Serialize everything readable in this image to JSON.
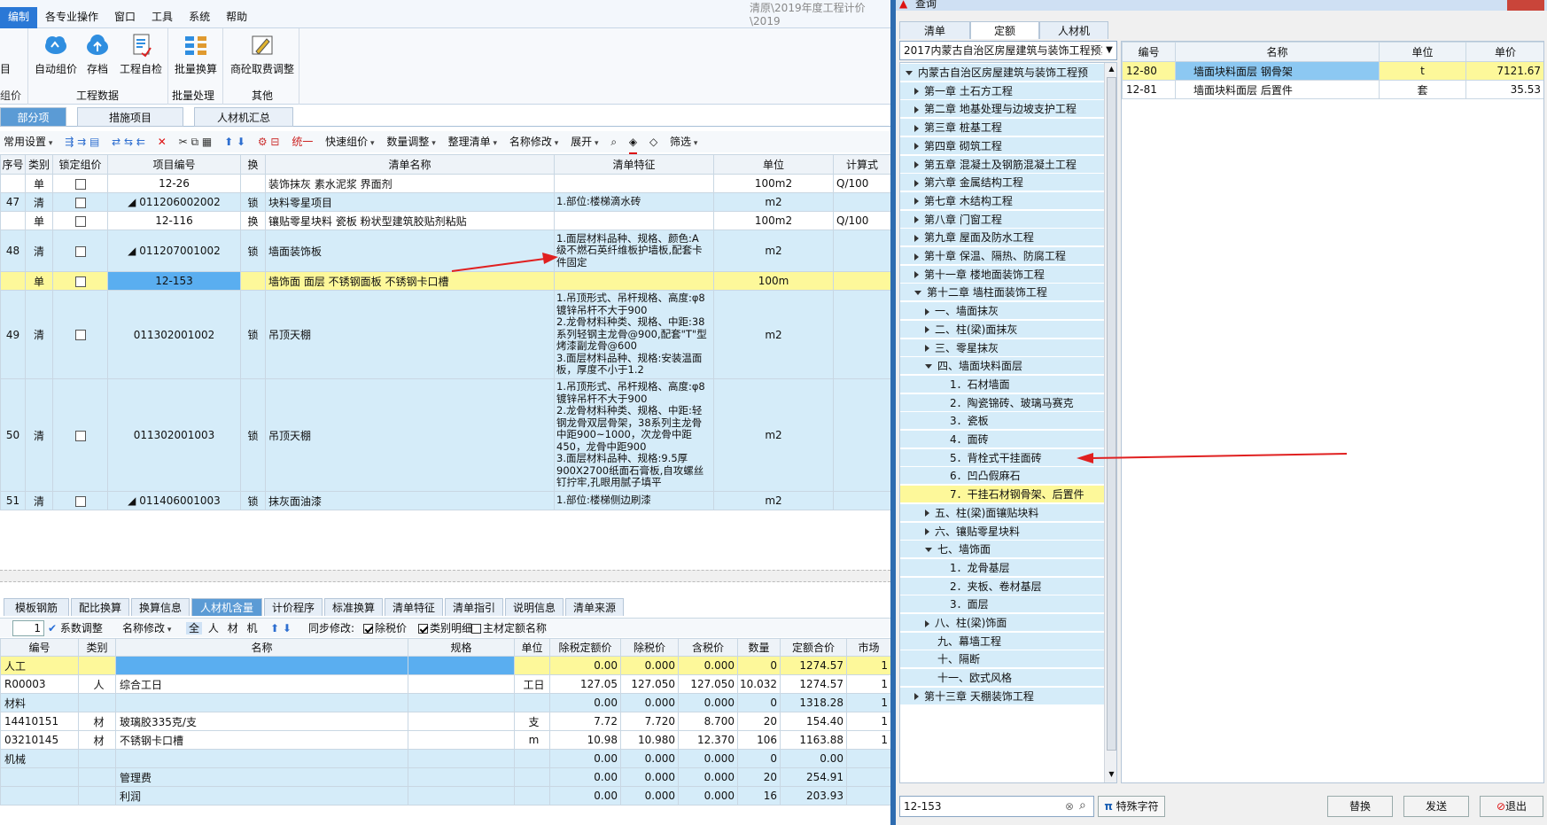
{
  "menu": {
    "items": [
      "编制",
      "各专业操作",
      "窗口",
      "工具",
      "系统",
      "帮助"
    ],
    "title_fragment": "清原\\2019年度工程计价\\2019"
  },
  "ribbon": {
    "groups": [
      {
        "label": "组价",
        "buttons": [
          "目"
        ]
      },
      {
        "label": "工程数据",
        "buttons": [
          "自动组价",
          "存档",
          "工程自检"
        ]
      },
      {
        "label": "批量处理",
        "buttons": [
          "批量换算"
        ]
      },
      {
        "label": "其他",
        "buttons": [
          "商砼取费调整"
        ]
      }
    ]
  },
  "main_tabs": [
    "部分项",
    "措施项目",
    "人材机汇总"
  ],
  "toolbar": [
    "常用设置",
    "统一",
    "快速组价",
    "数量调整",
    "整理清单",
    "名称修改",
    "展开",
    "筛选"
  ],
  "grid": {
    "headers": [
      "序号",
      "类别",
      "锁定组价",
      "项目编号",
      "换",
      "清单名称",
      "清单特征",
      "单位",
      "计算式"
    ],
    "rows": [
      {
        "no": "",
        "type": "单",
        "code": "12-26",
        "swap": "",
        "name": "装饰抹灰 素水泥浆 界面剂",
        "feature": "",
        "unit": "100m2",
        "calc": "Q/100",
        "style": "sub",
        "h": 21
      },
      {
        "no": "47",
        "type": "清",
        "code": "◢ 011206002002",
        "swap": "锁",
        "name": "块料零星项目",
        "feature": "1.部位:楼梯滴水砖",
        "unit": "m2",
        "calc": "",
        "style": "list",
        "h": 21
      },
      {
        "no": "",
        "type": "单",
        "code": "12-116",
        "swap": "换",
        "name": "镶贴零星块料 瓷板 粉状型建筑胶贴剂粘贴",
        "feature": "",
        "unit": "100m2",
        "calc": "Q/100",
        "style": "sub",
        "h": 21
      },
      {
        "no": "48",
        "type": "清",
        "code": "◢ 011207001002",
        "swap": "锁",
        "name": "墙面装饰板",
        "feature": "1.面层材料品种、规格、颜色:A\n级不燃石英纤维板护墙板,配套卡\n件固定",
        "unit": "m2",
        "calc": "",
        "style": "list",
        "h": 47
      },
      {
        "no": "",
        "type": "单",
        "code": "12-153",
        "swap": "",
        "name": "墙饰面 面层 不锈钢面板 不锈钢卡口槽",
        "feature": "",
        "unit": "100m",
        "calc": "",
        "style": "sel",
        "h": 21
      },
      {
        "no": "49",
        "type": "清",
        "code": "011302001002",
        "swap": "锁",
        "name": "吊顶天棚",
        "feature": "1.吊顶形式、吊杆规格、高度:φ8\n镀锌吊杆不大于900\n2.龙骨材料种类、规格、中距:38\n系列轻钢主龙骨@900,配套\"T\"型\n烤漆副龙骨@600\n3.面层材料品种、规格:安装温面\n板，厚度不小于1.2",
        "unit": "m2",
        "calc": "",
        "style": "list",
        "h": 100
      },
      {
        "no": "50",
        "type": "清",
        "code": "011302001003",
        "swap": "锁",
        "name": "吊顶天棚",
        "feature": "1.吊顶形式、吊杆规格、高度:φ8\n镀锌吊杆不大于900\n2.龙骨材料种类、规格、中距:轻\n钢龙骨双层骨架，38系列主龙骨\n中距900~1000，次龙骨中距\n450，龙骨中距900\n3.面层材料品种、规格:9.5厚\n900X2700纸面石膏板,自攻螺丝\n钉拧牢,孔眼用腻子填平",
        "unit": "m2",
        "calc": "",
        "style": "list",
        "h": 127
      },
      {
        "no": "51",
        "type": "清",
        "code": "◢ 011406001003",
        "swap": "锁",
        "name": "抹灰面油漆",
        "feature": "1.部位:楼梯侧边刷漆",
        "unit": "m2",
        "calc": "",
        "style": "list",
        "h": 21
      }
    ]
  },
  "bottom_tabs": [
    "模板钢筋",
    "配比换算",
    "换算信息",
    "人材机含量",
    "计价程序",
    "标准换算",
    "清单特征",
    "清单指引",
    "说明信息",
    "清单来源"
  ],
  "bottom_toolbar": {
    "qty": "1",
    "coef_label": "系数调整",
    "name_label": "名称修改",
    "filters": [
      "全",
      "人",
      "材",
      "机"
    ],
    "sync": "同步修改:",
    "chk1": "除税价",
    "chk2": "类别明细",
    "chk3": "主材定额名称"
  },
  "rcj": {
    "headers": [
      "编号",
      "类别",
      "名称",
      "规格",
      "单位",
      "除税定额价",
      "除税价",
      "含税价",
      "数量",
      "定额合价",
      "市场"
    ],
    "rows": [
      {
        "code": "人工",
        "type": "",
        "name": "",
        "spec": "",
        "unit": "",
        "p1": "0.00",
        "p2": "0.000",
        "p3": "0.000",
        "qty": "0",
        "total": "1274.57",
        "m": "1",
        "style": "sel"
      },
      {
        "code": "R00003",
        "type": "人",
        "name": "综合工日",
        "spec": "",
        "unit": "工日",
        "p1": "127.05",
        "p2": "127.050",
        "p3": "127.050",
        "qty": "10.032",
        "total": "1274.57",
        "m": "1",
        "style": "plain"
      },
      {
        "code": "材料",
        "type": "",
        "name": "",
        "spec": "",
        "unit": "",
        "p1": "0.00",
        "p2": "0.000",
        "p3": "0.000",
        "qty": "0",
        "total": "1318.28",
        "m": "1",
        "style": "grp"
      },
      {
        "code": "14410151",
        "type": "材",
        "name": "玻璃胶335克/支",
        "spec": "",
        "unit": "支",
        "p1": "7.72",
        "p2": "7.720",
        "p3": "8.700",
        "qty": "20",
        "total": "154.40",
        "m": "1",
        "style": "plain"
      },
      {
        "code": "03210145",
        "type": "材",
        "name": "不锈钢卡口槽",
        "spec": "",
        "unit": "m",
        "p1": "10.98",
        "p2": "10.980",
        "p3": "12.370",
        "qty": "106",
        "total": "1163.88",
        "m": "1",
        "style": "plain"
      },
      {
        "code": "机械",
        "type": "",
        "name": "",
        "spec": "",
        "unit": "",
        "p1": "0.00",
        "p2": "0.000",
        "p3": "0.000",
        "qty": "0",
        "total": "0.00",
        "m": "",
        "style": "grp"
      },
      {
        "code": "",
        "type": "",
        "name": "管理费",
        "spec": "",
        "unit": "",
        "p1": "0.00",
        "p2": "0.000",
        "p3": "0.000",
        "qty": "20",
        "total": "254.91",
        "m": "",
        "style": "grp"
      },
      {
        "code": "",
        "type": "",
        "name": "利润",
        "spec": "",
        "unit": "",
        "p1": "0.00",
        "p2": "0.000",
        "p3": "0.000",
        "qty": "16",
        "total": "203.93",
        "m": "",
        "style": "grp"
      }
    ]
  },
  "query": {
    "title": "查询",
    "tabs": [
      "清单",
      "定额",
      "人材机"
    ],
    "active_tab": 1,
    "library": "2017内蒙古自治区房屋建筑与装饰工程预算定额",
    "tree": [
      {
        "label": "内蒙古自治区房屋建筑与装饰工程预",
        "lvl": 0,
        "exp": "open",
        "sel": false
      },
      {
        "label": "第一章 土石方工程",
        "lvl": 1,
        "exp": "closed",
        "sel": false
      },
      {
        "label": "第二章 地基处理与边坡支护工程",
        "lvl": 1,
        "exp": "closed",
        "sel": false
      },
      {
        "label": "第三章 桩基工程",
        "lvl": 1,
        "exp": "closed",
        "sel": false
      },
      {
        "label": "第四章 砌筑工程",
        "lvl": 1,
        "exp": "closed",
        "sel": false
      },
      {
        "label": "第五章 混凝土及钢筋混凝土工程",
        "lvl": 1,
        "exp": "closed",
        "sel": false
      },
      {
        "label": "第六章 金属结构工程",
        "lvl": 1,
        "exp": "closed",
        "sel": false
      },
      {
        "label": "第七章 木结构工程",
        "lvl": 1,
        "exp": "closed",
        "sel": false
      },
      {
        "label": "第八章 门窗工程",
        "lvl": 1,
        "exp": "closed",
        "sel": false
      },
      {
        "label": "第九章 屋面及防水工程",
        "lvl": 1,
        "exp": "closed",
        "sel": false
      },
      {
        "label": "第十章 保温、隔热、防腐工程",
        "lvl": 1,
        "exp": "closed",
        "sel": false
      },
      {
        "label": "第十一章 楼地面装饰工程",
        "lvl": 1,
        "exp": "closed",
        "sel": false
      },
      {
        "label": "第十二章 墙柱面装饰工程",
        "lvl": 1,
        "exp": "open",
        "sel": false
      },
      {
        "label": "一、墙面抹灰",
        "lvl": 2,
        "exp": "closed",
        "sel": false
      },
      {
        "label": "二、柱(梁)面抹灰",
        "lvl": 2,
        "exp": "closed",
        "sel": false
      },
      {
        "label": "三、零星抹灰",
        "lvl": 2,
        "exp": "closed",
        "sel": false
      },
      {
        "label": "四、墙面块料面层",
        "lvl": 2,
        "exp": "open",
        "sel": false
      },
      {
        "label": "1．石材墙面",
        "lvl": 3,
        "exp": "",
        "sel": false
      },
      {
        "label": "2．陶瓷锦砖、玻璃马赛克",
        "lvl": 3,
        "exp": "",
        "sel": false
      },
      {
        "label": "3．瓷板",
        "lvl": 3,
        "exp": "",
        "sel": false
      },
      {
        "label": "4．面砖",
        "lvl": 3,
        "exp": "",
        "sel": false
      },
      {
        "label": "5．背栓式干挂面砖",
        "lvl": 3,
        "exp": "",
        "sel": false
      },
      {
        "label": "6．凹凸假麻石",
        "lvl": 3,
        "exp": "",
        "sel": false
      },
      {
        "label": "7．干挂石材钢骨架、后置件",
        "lvl": 3,
        "exp": "",
        "sel": true
      },
      {
        "label": "五、柱(梁)面镶贴块料",
        "lvl": 2,
        "exp": "closed",
        "sel": false
      },
      {
        "label": "六、镶贴零星块料",
        "lvl": 2,
        "exp": "closed",
        "sel": false
      },
      {
        "label": "七、墙饰面",
        "lvl": 2,
        "exp": "open",
        "sel": false
      },
      {
        "label": "1．龙骨基层",
        "lvl": 3,
        "exp": "",
        "sel": false
      },
      {
        "label": "2．夹板、卷材基层",
        "lvl": 3,
        "exp": "",
        "sel": false
      },
      {
        "label": "3．面层",
        "lvl": 3,
        "exp": "",
        "sel": false
      },
      {
        "label": "八、柱(梁)饰面",
        "lvl": 2,
        "exp": "closed",
        "sel": false
      },
      {
        "label": "九、幕墙工程",
        "lvl": 2,
        "exp": "",
        "sel": false
      },
      {
        "label": "十、隔断",
        "lvl": 2,
        "exp": "",
        "sel": false
      },
      {
        "label": "十一、欧式风格",
        "lvl": 2,
        "exp": "",
        "sel": false
      },
      {
        "label": "第十三章 天棚装饰工程",
        "lvl": 1,
        "exp": "closed",
        "sel": false
      }
    ],
    "result_headers": [
      "编号",
      "名称",
      "单位",
      "单价"
    ],
    "results": [
      {
        "code": "12-80",
        "name": "墙面块料面层 钢骨架",
        "unit": "t",
        "price": "7121.67",
        "sel": true
      },
      {
        "code": "12-81",
        "name": "墙面块料面层 后置件",
        "unit": "套",
        "price": "35.53",
        "sel": false
      }
    ],
    "search_value": "12-153",
    "special_char": "特殊字符",
    "buttons": [
      "替换",
      "发送",
      "退出"
    ]
  }
}
